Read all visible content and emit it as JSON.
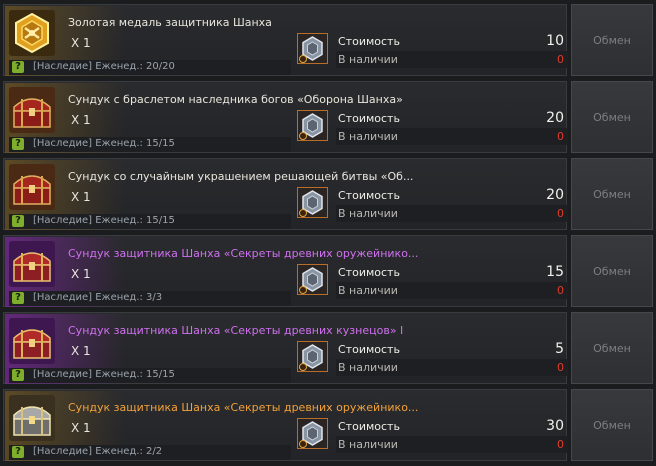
{
  "labels": {
    "cost": "Стоимость",
    "stock": "В наличии",
    "exchange": "Обмен"
  },
  "items": [
    {
      "name": "Золотая медаль защитника Шанха",
      "name_color": "white",
      "icon": "gold-medal-icon",
      "glow": "gold",
      "qty": "X 1",
      "info": "[Наследие] Еженед.: 20/20",
      "cost": "10",
      "stock": "0"
    },
    {
      "name": "Сундук с браслетом наследника богов «Оборона Шанха»",
      "name_color": "white",
      "icon": "red-chest-icon",
      "glow": "gold",
      "qty": "X 1",
      "info": "[Наследие] Еженед.: 15/15",
      "cost": "20",
      "stock": "0"
    },
    {
      "name": "Сундук со случайным украшением решающей битвы «Об...",
      "name_color": "white",
      "icon": "red-chest-icon",
      "glow": "gold",
      "qty": "X 1",
      "info": "[Наследие] Еженед.: 15/15",
      "cost": "20",
      "stock": "0"
    },
    {
      "name": "Сундук защитника Шанха «Секреты древних оружейнико...",
      "name_color": "purple",
      "icon": "purple-chest-icon",
      "glow": "purple",
      "qty": "X 1",
      "info": "[Наследие] Еженед.: 3/3",
      "cost": "15",
      "stock": "0"
    },
    {
      "name": "Сундук защитника Шанха «Секреты древних кузнецов» I",
      "name_color": "purple",
      "icon": "purple-chest-icon",
      "glow": "purple",
      "qty": "X 1",
      "info": "[Наследие] Еженед.: 15/15",
      "cost": "5",
      "stock": "0"
    },
    {
      "name": "Сундук защитника Шанха «Секреты древних оружейнико...",
      "name_color": "orange",
      "icon": "silver-chest-icon",
      "glow": "gold",
      "qty": "X 1",
      "info": "[Наследие] Еженед.: 2/2",
      "cost": "30",
      "stock": "0"
    }
  ]
}
